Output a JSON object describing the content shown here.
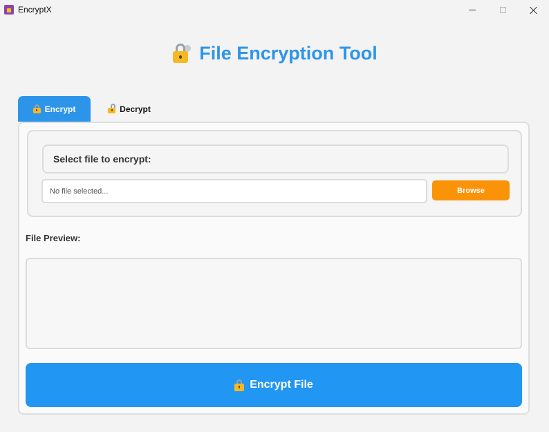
{
  "window": {
    "title": "EncryptX",
    "icons": {
      "app": "app-lock-icon",
      "minimize": "minimize-icon",
      "maximize": "maximize-icon",
      "close": "close-icon"
    }
  },
  "header": {
    "title": "File Encryption Tool",
    "icon": "lock-with-key-icon",
    "color": "#2d95e9"
  },
  "tabs": [
    {
      "label": "Encrypt",
      "icon": "lock-icon",
      "active": true
    },
    {
      "label": "Decrypt",
      "icon": "unlock-icon",
      "active": false
    }
  ],
  "file_select": {
    "label": "Select file to encrypt:",
    "input_placeholder": "No file selected...",
    "browse_label": "Browse",
    "browse_color": "#fb9309"
  },
  "preview": {
    "label": "File Preview:",
    "content": ""
  },
  "action": {
    "label": "Encrypt File",
    "icon": "lock-icon",
    "color": "#2196f3"
  }
}
